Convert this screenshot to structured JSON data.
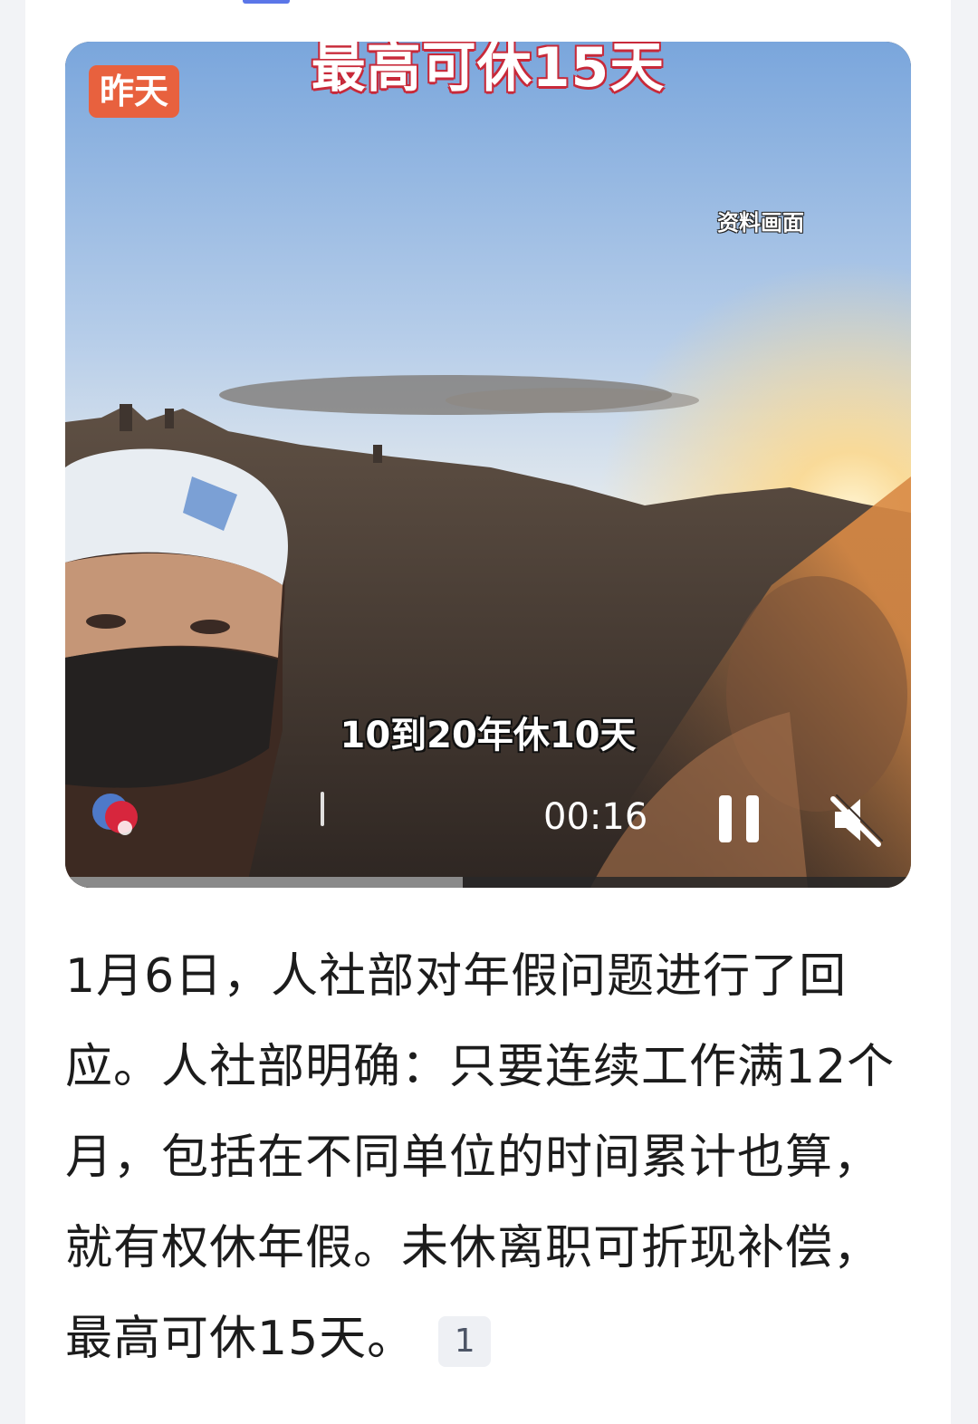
{
  "video": {
    "date_badge": "昨天",
    "overlay_title": "最高可休15天",
    "source_tag": "资料画面",
    "subtitle": "10到20年休10天",
    "time": "00:16",
    "progress": 0.47,
    "colors": {
      "badge": "#e8613e",
      "title_outline": "#c82a3a"
    },
    "controls": {
      "pause_icon": "pause-icon",
      "mute_icon": "volume-muted-icon",
      "logo_icon": "channel-logo-icon"
    }
  },
  "article": {
    "text": "1月6日，人社部对年假问题进行了回应。人社部明确：只要连续工作满12个月，包括在不同单位的时间累计也算，就有权休年假。未休离职可折现补偿，最高可休15天。",
    "ref_number": "1"
  }
}
